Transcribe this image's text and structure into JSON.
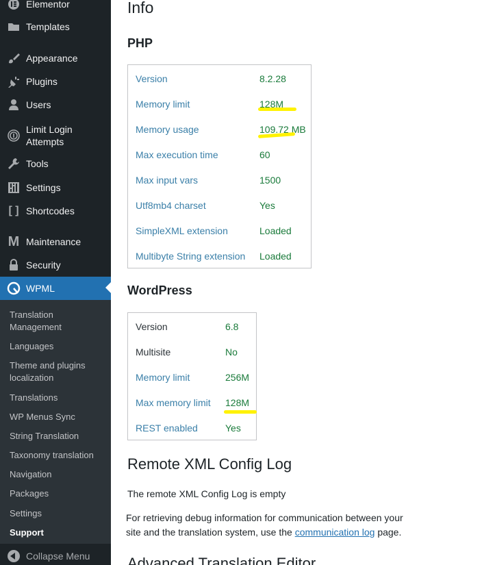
{
  "sidebar": {
    "items": [
      {
        "label": "Elementor",
        "icon": "elementor-icon"
      },
      {
        "label": "Templates",
        "icon": "folder-icon"
      },
      {
        "label": "Appearance",
        "icon": "brush-icon"
      },
      {
        "label": "Plugins",
        "icon": "plug-icon"
      },
      {
        "label": "Users",
        "icon": "user-icon"
      },
      {
        "label": "Limit Login Attempts",
        "icon": "fingerprint-icon"
      },
      {
        "label": "Tools",
        "icon": "wrench-icon"
      },
      {
        "label": "Settings",
        "icon": "sliders-icon"
      },
      {
        "label": "Shortcodes",
        "icon": "brackets-icon"
      },
      {
        "label": "Maintenance",
        "icon": "m-logo-icon"
      },
      {
        "label": "Security",
        "icon": "lock-icon"
      },
      {
        "label": "WPML",
        "icon": "wpml-icon"
      }
    ],
    "submenu": [
      "Translation Management",
      "Languages",
      "Theme and plugins localization",
      "Translations",
      "WP Menus Sync",
      "String Translation",
      "Taxonomy translation",
      "Navigation",
      "Packages",
      "Settings",
      "Support"
    ],
    "collapse_label": "Collapse Menu"
  },
  "main": {
    "title": "Info",
    "php": {
      "heading": "PHP",
      "rows": [
        {
          "key": "Version",
          "value": "8.2.28"
        },
        {
          "key": "Memory limit",
          "value": "128M"
        },
        {
          "key": "Memory usage",
          "value": "109.72 MB"
        },
        {
          "key": "Max execution time",
          "value": "60"
        },
        {
          "key": "Max input vars",
          "value": "1500"
        },
        {
          "key": "Utf8mb4 charset",
          "value": "Yes"
        },
        {
          "key": "SimpleXML extension",
          "value": "Loaded"
        },
        {
          "key": "Multibyte String extension",
          "value": "Loaded"
        }
      ]
    },
    "wordpress": {
      "heading": "WordPress",
      "rows": [
        {
          "key": "Version",
          "value": "6.8"
        },
        {
          "key": "Multisite",
          "value": "No"
        },
        {
          "key": "Memory limit",
          "value": "256M"
        },
        {
          "key": "Max memory limit",
          "value": "128M"
        },
        {
          "key": "REST enabled",
          "value": "Yes"
        }
      ]
    },
    "remote_log": {
      "heading": "Remote XML Config Log",
      "empty_text": "The remote XML Config Log is empty",
      "para_before": "For retrieving debug information for communication between your site and the translation system, use the ",
      "link_text": "communication log",
      "para_after": " page."
    },
    "next_heading": "Advanced Translation Editor"
  },
  "colors": {
    "sidebar_bg": "#1d2327",
    "submenu_bg": "#2c3338",
    "active_bg": "#2271b1",
    "highlight": "#fff200",
    "value_green": "#197a3a",
    "key_blue": "#3a7fa8"
  }
}
